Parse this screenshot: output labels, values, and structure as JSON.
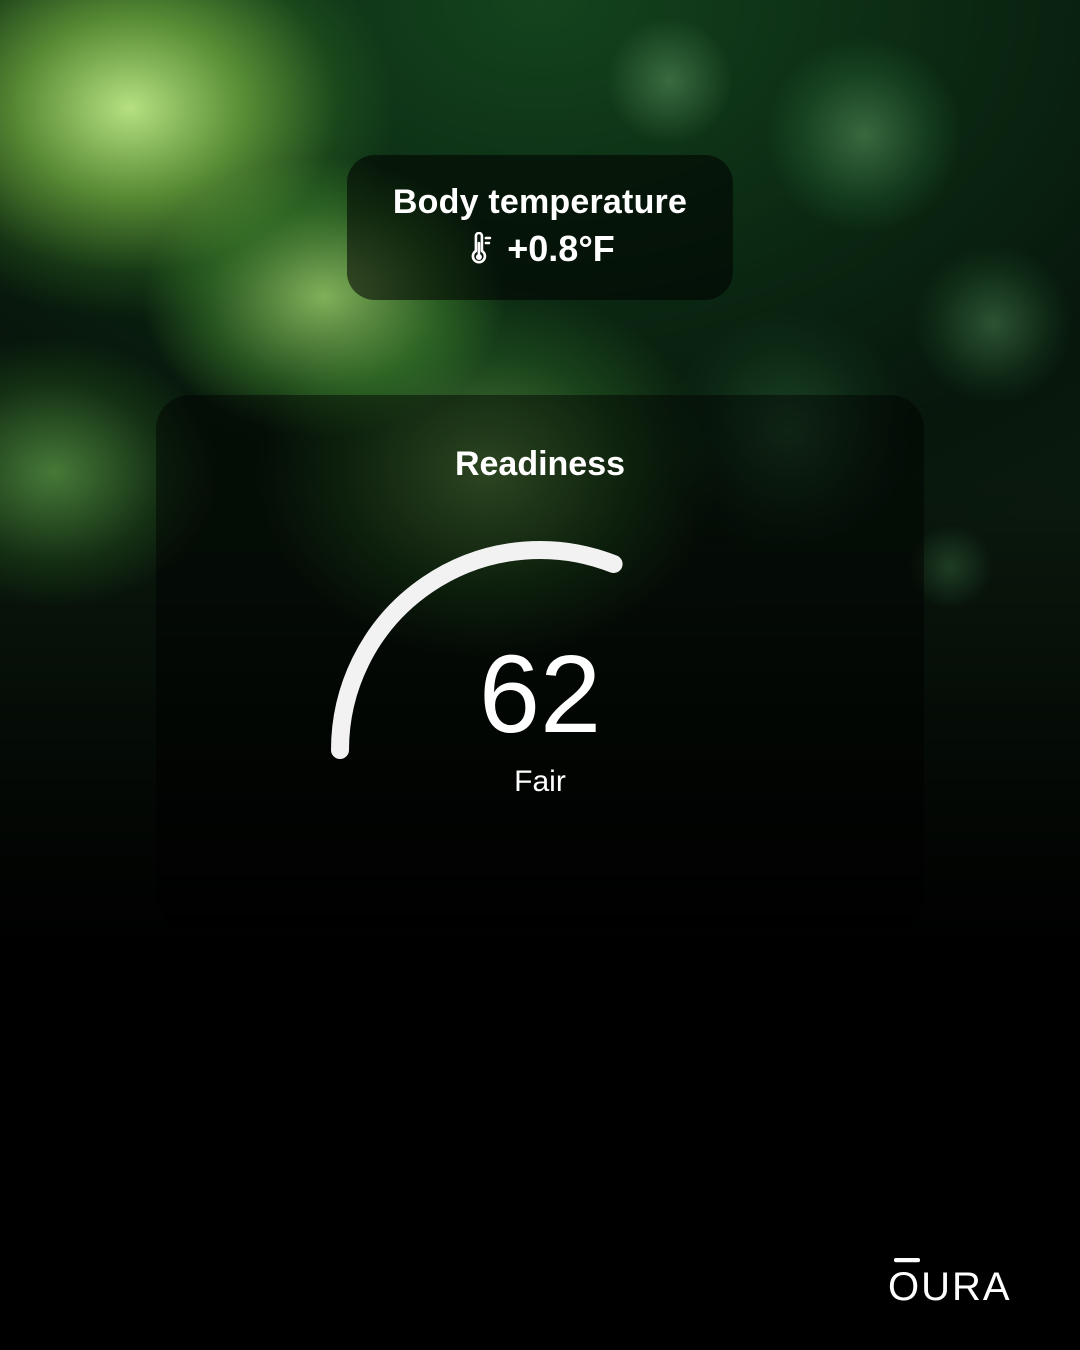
{
  "temperature_card": {
    "title": "Body temperature",
    "value": "+0.8°F"
  },
  "readiness_card": {
    "title": "Readiness",
    "score": "62",
    "score_numeric": 62,
    "label": "Fair"
  },
  "brand": {
    "name": "ŌURA"
  },
  "colors": {
    "card_bg": "rgba(0,0,0,0.55)",
    "text": "#ffffff"
  }
}
